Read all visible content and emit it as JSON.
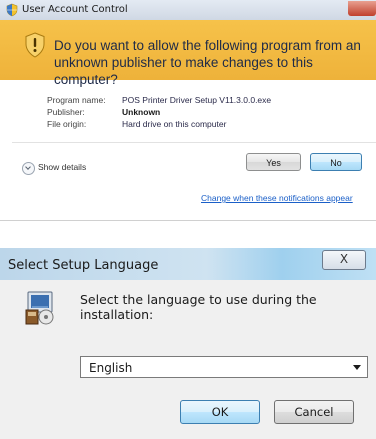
{
  "uac": {
    "title": "User Account Control",
    "question": "Do you want to allow the following program from an unknown publisher to make changes to this computer?",
    "details": [
      {
        "key": "Program name:",
        "value": "POS Printer Driver Setup V11.3.0.0.exe"
      },
      {
        "key": "Publisher:",
        "value": "Unknown"
      },
      {
        "key": "File origin:",
        "value": "Hard drive on this computer"
      }
    ],
    "show_details_label": "Show details",
    "yes_label": "Yes",
    "no_label": "No",
    "notifications_link": "Change when these notifications appear",
    "banner_color": "#f1b73f"
  },
  "lang_dialog": {
    "title": "Select Setup Language",
    "close_label": "X",
    "prompt": "Select the language to use during the installation:",
    "selected_language": "English",
    "ok_label": "OK",
    "cancel_label": "Cancel"
  }
}
